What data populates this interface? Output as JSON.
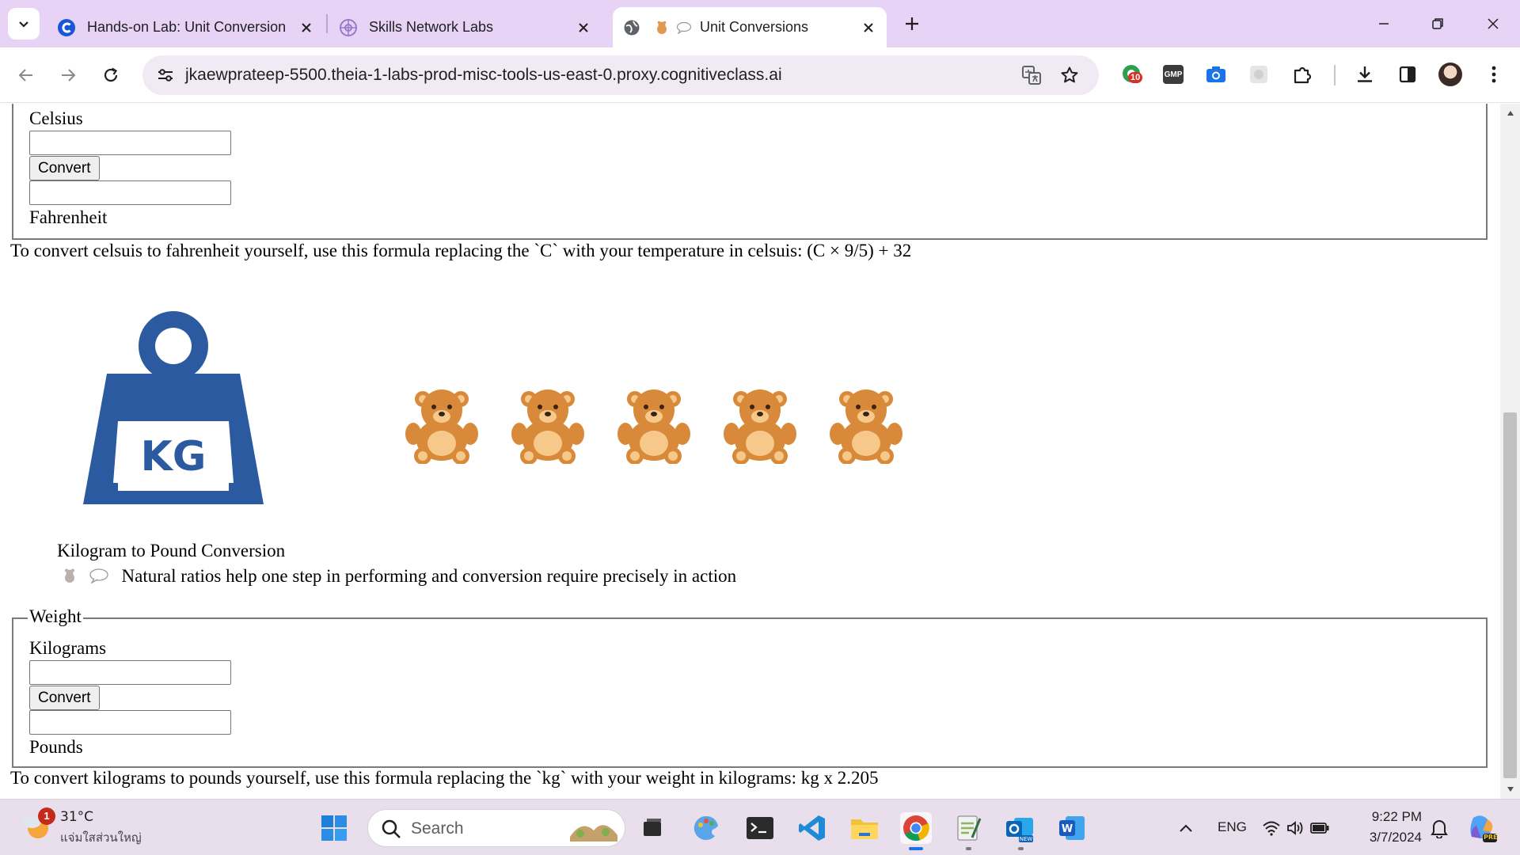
{
  "browser": {
    "tabs": [
      {
        "title": "Hands-on Lab: Unit Conversion",
        "favicon": "coursera-c-icon",
        "active": false
      },
      {
        "title": "Skills Network Labs",
        "favicon": "skills-network-icon",
        "active": false
      },
      {
        "title": "Unit Conversions",
        "favicon": "globe-icon",
        "active": true
      }
    ],
    "address": "jkaewprateep-5500.theia-1-labs-prod-misc-tools-us-east-0.proxy.cognitiveclass.ai",
    "extension_badge": "10",
    "gmp_label": "GMP"
  },
  "page": {
    "temperature": {
      "input_label": "Celsius",
      "convert_label": "Convert",
      "output_label": "Fahrenheit",
      "formula_text": "To convert celsuis to fahrenheit yourself, use this formula replacing the `C` with your temperature in celsuis: (C × 9/5) + 32"
    },
    "kg_logo_text": "KG",
    "section_title": "Kilogram to Pound Conversion",
    "section_subtitle": "Natural ratios help one step in performing and conversion require precisely in action",
    "bear_count": 5,
    "weight": {
      "legend": "Weight",
      "input_label": "Kilograms",
      "convert_label": "Convert",
      "output_label": "Pounds",
      "formula_text": "To convert kilograms to pounds yourself, use this formula replacing the `kg` with your weight in kilograms: kg x 2.205"
    }
  },
  "taskbar": {
    "weather_temp": "31°C",
    "weather_desc": "แจ่มใสส่วนใหญ่",
    "weather_badge": "1",
    "search_placeholder": "Search",
    "language": "ENG",
    "time": "9:22 PM",
    "date": "3/7/2024",
    "copilot_badge": "PRE"
  },
  "colors": {
    "tabstrip": "#e6d3f5",
    "kg_blue": "#2c5aa0",
    "bear_body": "#d9893a",
    "bear_belly": "#f6c98a"
  }
}
